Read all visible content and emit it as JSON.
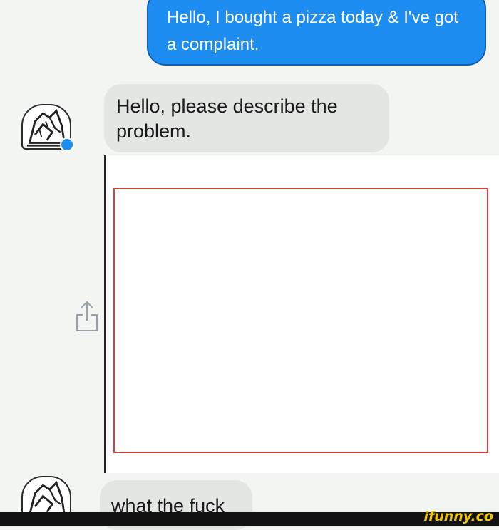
{
  "conversation": {
    "messages": [
      {
        "side": "outgoing",
        "text": "Hello, I bought a pizza today & I've got a complaint."
      },
      {
        "side": "incoming",
        "text": "Hello, please describe the problem."
      },
      {
        "side": "incoming",
        "text": "what the fuck"
      }
    ]
  },
  "attachment": {
    "icon": "share-icon"
  },
  "avatar": {
    "icon": "pizza-brand-logo-icon",
    "badge": "messenger-badge-icon"
  },
  "watermark": {
    "text": "ifunny.co"
  },
  "colors": {
    "outgoing_bubble": "#1d8df2",
    "incoming_bubble": "#e4e6e4",
    "frame": "#d64040",
    "watermark": "#f2c500"
  }
}
